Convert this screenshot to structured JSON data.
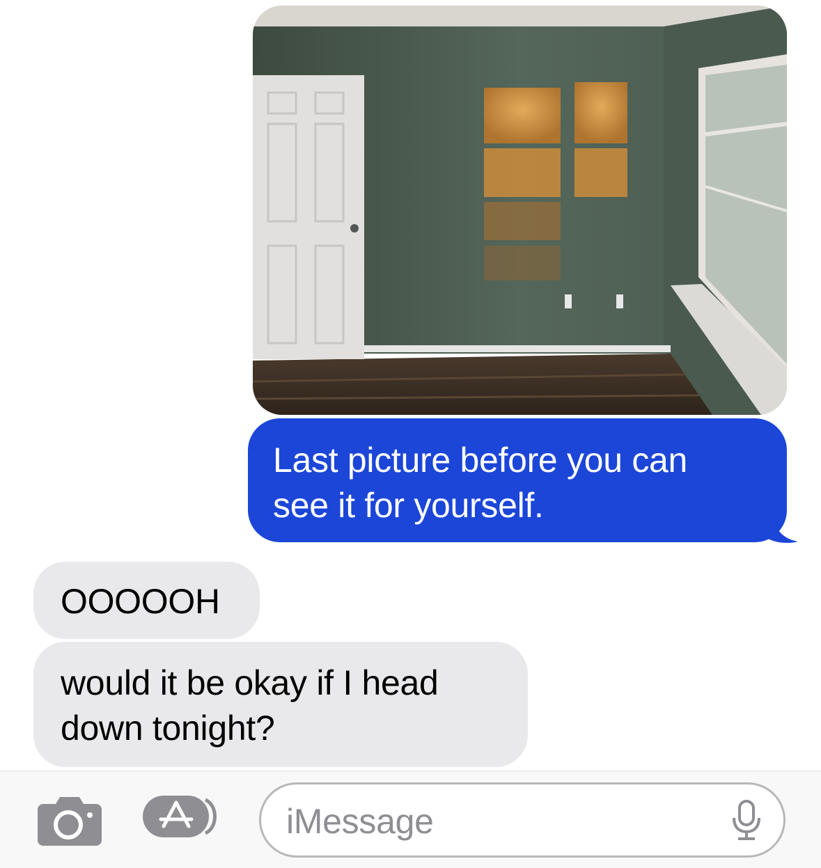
{
  "conversation": {
    "photo": {
      "icon": "room-photo",
      "description_hidden": true
    },
    "messages": [
      {
        "direction": "outgoing",
        "text_lines": [
          "Last picture before you can",
          "see it for yourself."
        ]
      },
      {
        "direction": "incoming",
        "text_lines": [
          "OOOOOH"
        ]
      },
      {
        "direction": "incoming",
        "text_lines": [
          "would it be okay if I head",
          "down tonight?"
        ]
      }
    ]
  },
  "input_bar": {
    "camera_icon": "camera-icon",
    "apps_icon": "app-store-icon",
    "placeholder": "iMessage",
    "mic_icon": "microphone-icon"
  },
  "colors": {
    "outgoing_bubble": "#1c46d8",
    "incoming_bubble": "#e9e9eb",
    "icon_gray": "#8e8e93"
  }
}
